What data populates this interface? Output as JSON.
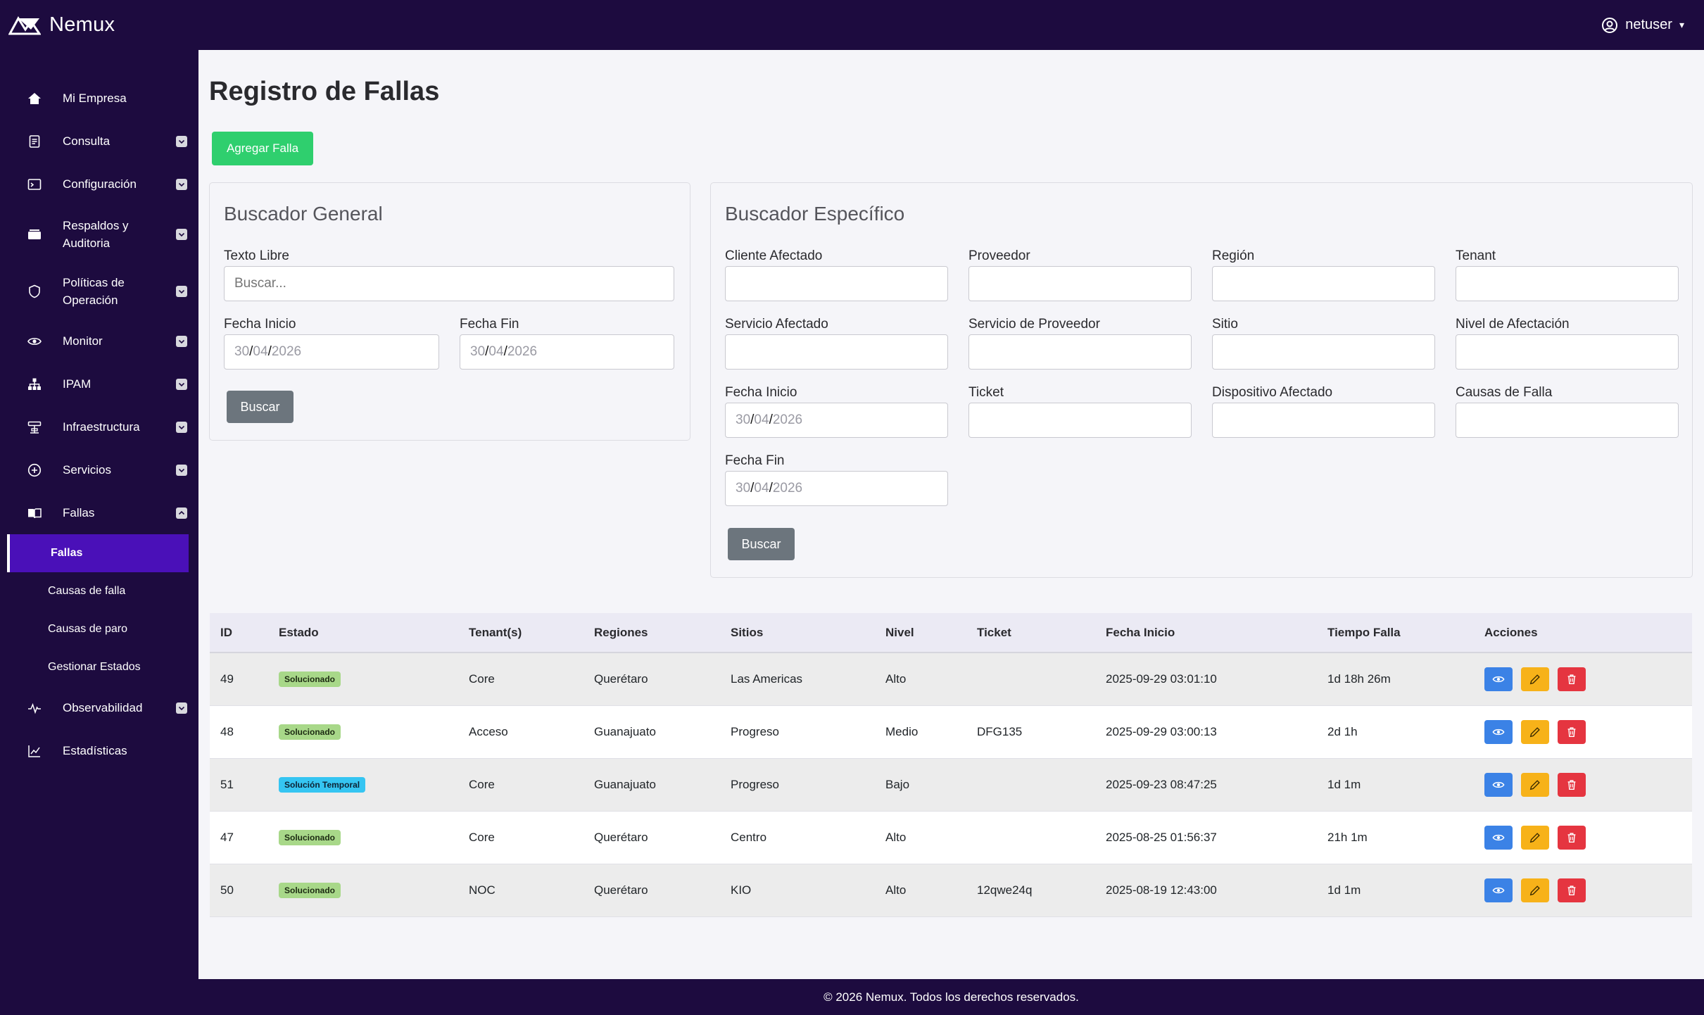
{
  "app": {
    "name": "Nemux",
    "user": "netuser"
  },
  "sidebar": {
    "items": [
      {
        "label": "Mi Empresa",
        "icon": "home-icon"
      },
      {
        "label": "Consulta",
        "icon": "document-icon"
      },
      {
        "label": "Configuración",
        "icon": "terminal-icon"
      },
      {
        "label": "Respaldos y Auditoria",
        "icon": "archive-icon"
      },
      {
        "label": "Políticas de Operación",
        "icon": "shield-icon"
      },
      {
        "label": "Monitor",
        "icon": "eye-icon"
      },
      {
        "label": "IPAM",
        "icon": "network-icon"
      },
      {
        "label": "Infraestructura",
        "icon": "rack-icon"
      },
      {
        "label": "Servicios",
        "icon": "plus-circle-icon"
      },
      {
        "label": "Fallas",
        "icon": "book-icon"
      },
      {
        "label": "Observabilidad",
        "icon": "pulse-icon"
      },
      {
        "label": "Estadísticas",
        "icon": "chart-icon"
      }
    ],
    "fallas_sub": [
      "Fallas",
      "Causas de falla",
      "Causas de paro",
      "Gestionar Estados"
    ]
  },
  "page": {
    "title": "Registro de Fallas",
    "add_button": "Agregar Falla"
  },
  "general": {
    "title": "Buscador General",
    "texto_label": "Texto Libre",
    "texto_placeholder": "Buscar...",
    "fecha_inicio_label": "Fecha Inicio",
    "fecha_fin_label": "Fecha Fin",
    "date_dd": "30",
    "date_mm": "04",
    "date_yyyy": "2026",
    "search_button": "Buscar"
  },
  "specific": {
    "title": "Buscador Específico",
    "labels": {
      "cliente": "Cliente Afectado",
      "proveedor": "Proveedor",
      "region": "Región",
      "tenant": "Tenant",
      "servicio": "Servicio Afectado",
      "servicio_proveedor": "Servicio de Proveedor",
      "sitio": "Sitio",
      "nivel": "Nivel de Afectación",
      "fecha_inicio": "Fecha Inicio",
      "ticket": "Ticket",
      "dispositivo": "Dispositivo Afectado",
      "causas": "Causas de Falla",
      "fecha_fin": "Fecha Fin"
    },
    "search_button": "Buscar"
  },
  "table": {
    "headers": [
      "ID",
      "Estado",
      "Tenant(s)",
      "Regiones",
      "Sitios",
      "Nivel",
      "Ticket",
      "Fecha Inicio",
      "Tiempo Falla",
      "Acciones"
    ],
    "rows": [
      {
        "id": "49",
        "estado": "Solucionado",
        "tenant": "Core",
        "region": "Querétaro",
        "sitio": "Las Americas",
        "nivel": "Alto",
        "ticket": "",
        "fecha": "2025-09-29 03:01:10",
        "tiempo": "1d 18h 26m"
      },
      {
        "id": "48",
        "estado": "Solucionado",
        "tenant": "Acceso",
        "region": "Guanajuato",
        "sitio": "Progreso",
        "nivel": "Medio",
        "ticket": "DFG135",
        "fecha": "2025-09-29 03:00:13",
        "tiempo": "2d 1h"
      },
      {
        "id": "51",
        "estado": "Solución Temporal",
        "tenant": "Core",
        "region": "Guanajuato",
        "sitio": "Progreso",
        "nivel": "Bajo",
        "ticket": "",
        "fecha": "2025-09-23 08:47:25",
        "tiempo": "1d 1m"
      },
      {
        "id": "47",
        "estado": "Solucionado",
        "tenant": "Core",
        "region": "Querétaro",
        "sitio": "Centro",
        "nivel": "Alto",
        "ticket": "",
        "fecha": "2025-08-25 01:56:37",
        "tiempo": "21h 1m"
      },
      {
        "id": "50",
        "estado": "Solucionado",
        "tenant": "NOC",
        "region": "Querétaro",
        "sitio": "KIO",
        "nivel": "Alto",
        "ticket": "12qwe24q",
        "fecha": "2025-08-19 12:43:00",
        "tiempo": "1d 1m"
      }
    ]
  },
  "colors": {
    "sidebar_bg": "#1d0b3f",
    "active_item": "#4a10b8",
    "add_button": "#2fcf6e",
    "search_button": "#6c757d",
    "badge_solucionado": "#a8d889",
    "badge_temporal": "#35c5f2",
    "view": "#3b82e6",
    "edit": "#f7b219",
    "delete": "#e53540"
  },
  "footer": {
    "text": "© 2026 Nemux. Todos los derechos reservados."
  }
}
